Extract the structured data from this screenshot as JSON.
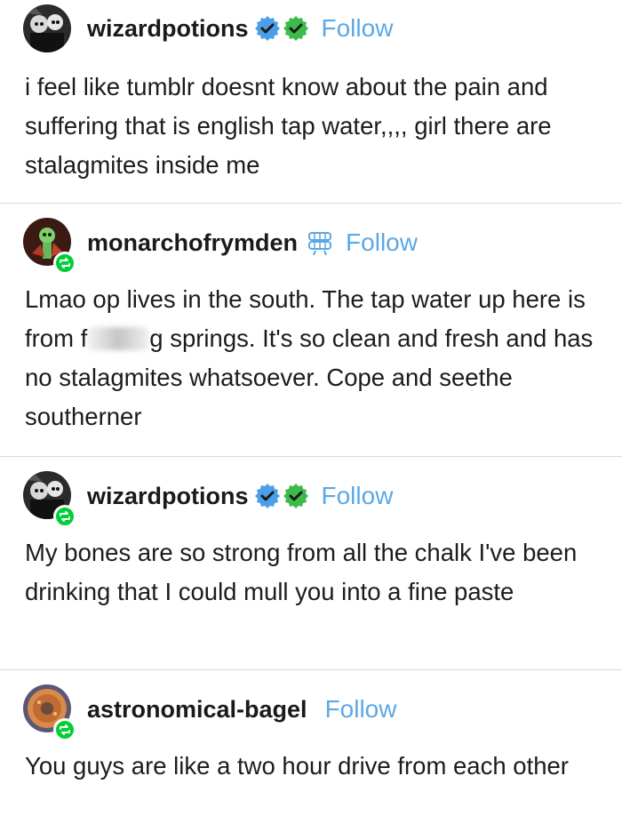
{
  "posts": [
    {
      "username": "wizardpotions",
      "follow_label": "Follow",
      "body": "i feel like tumblr doesnt know about the pain and suffering that is english tap water,,,, girl there are stalagmites inside me",
      "badges": [
        "blue-check-icon",
        "green-check-icon"
      ],
      "reblogged": false
    },
    {
      "username": "monarchofrymden",
      "follow_label": "Follow",
      "body_before": "Lmao op lives in the south. The tap water up here is from f",
      "body_after": "g springs. It's so clean and fresh and has no stalagmites whatsoever. Cope and seethe southerner",
      "badges": [
        "chattering-teeth-icon"
      ],
      "reblogged": true
    },
    {
      "username": "wizardpotions",
      "follow_label": "Follow",
      "body": "My bones are so strong from all the chalk I've been drinking that I could mull you into a fine paste",
      "badges": [
        "blue-check-icon",
        "green-check-icon"
      ],
      "reblogged": true
    },
    {
      "username": "astronomical-bagel",
      "follow_label": "Follow",
      "body": "You guys are like a two hour drive from each other",
      "badges": [],
      "reblogged": true
    }
  ],
  "colors": {
    "follow": "#5ba8e6",
    "reblog_badge": "#00cf35",
    "divider": "#d9d9d9",
    "blue_check": "#4b9fe8",
    "green_check": "#3dbb4a"
  }
}
